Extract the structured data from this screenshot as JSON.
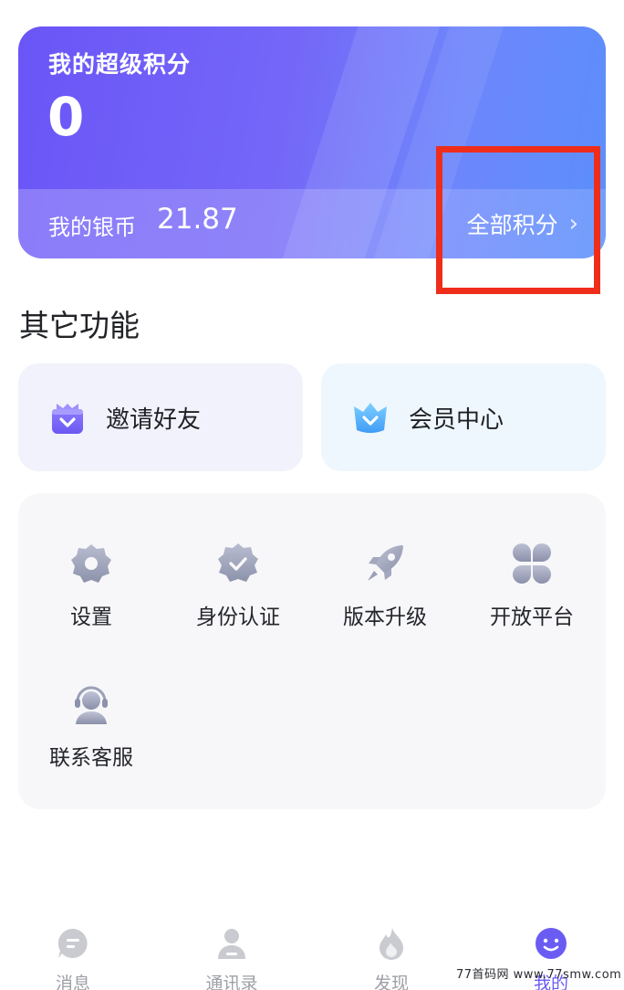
{
  "points_card": {
    "title": "我的超级积分",
    "value": "0",
    "silver_label": "我的银币",
    "silver_value": "21.87",
    "all_points_label": "全部积分",
    "chevron": "›"
  },
  "section": {
    "title": "其它功能"
  },
  "big_cards": [
    {
      "label": "邀请好友",
      "icon": "gift-icon"
    },
    {
      "label": "会员中心",
      "icon": "crown-heart-icon"
    }
  ],
  "grid": [
    {
      "label": "设置",
      "icon": "gear-icon"
    },
    {
      "label": "身份认证",
      "icon": "verified-badge-icon"
    },
    {
      "label": "版本升级",
      "icon": "rocket-icon"
    },
    {
      "label": "开放平台",
      "icon": "apps-grid-icon"
    },
    {
      "label": "联系客服",
      "icon": "headset-agent-icon"
    }
  ],
  "tabbar": [
    {
      "label": "消息",
      "icon": "chat-bubble-icon",
      "active": false
    },
    {
      "label": "通讯录",
      "icon": "contact-person-icon",
      "active": false
    },
    {
      "label": "发现",
      "icon": "flame-icon",
      "active": false
    },
    {
      "label": "我的",
      "icon": "smiley-icon",
      "active": true
    }
  ],
  "colors": {
    "card_gradient_start": "#6a55f7",
    "card_gradient_end": "#5b8ffb",
    "highlight_border": "#ee2d1a",
    "active_tab": "#6a5cf3",
    "icon_gray": "#9aa0b4"
  },
  "watermark": "77首码网 www.77smw.com"
}
